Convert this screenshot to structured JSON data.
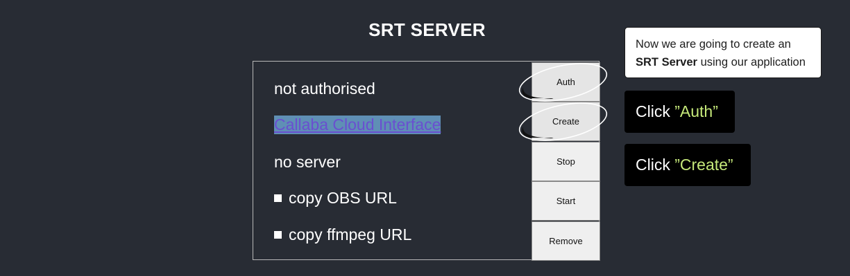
{
  "page": {
    "title": "SRT SERVER"
  },
  "status": {
    "auth": "not authorised",
    "link": "Callaba Cloud Interface",
    "server": "no server",
    "copy_obs": "copy OBS URL",
    "copy_ffmpeg": "copy ffmpeg URL"
  },
  "buttons": {
    "auth": "Auth",
    "create": "Create",
    "stop": "Stop",
    "start": "Start",
    "remove": "Remove"
  },
  "tutorial": {
    "intro_prefix": "Now we are going to create an",
    "intro_bold": "SRT Server",
    "intro_suffix": "using our application",
    "step1_prefix": "Click ",
    "step1_quoted": "”Auth”",
    "step2_prefix": "Click ",
    "step2_quoted": "”Create”"
  },
  "colors": {
    "background": "#282c34",
    "link_text": "#6a4fd0",
    "link_highlight": "#5f8fb5",
    "step_accent": "#c6e97a"
  }
}
